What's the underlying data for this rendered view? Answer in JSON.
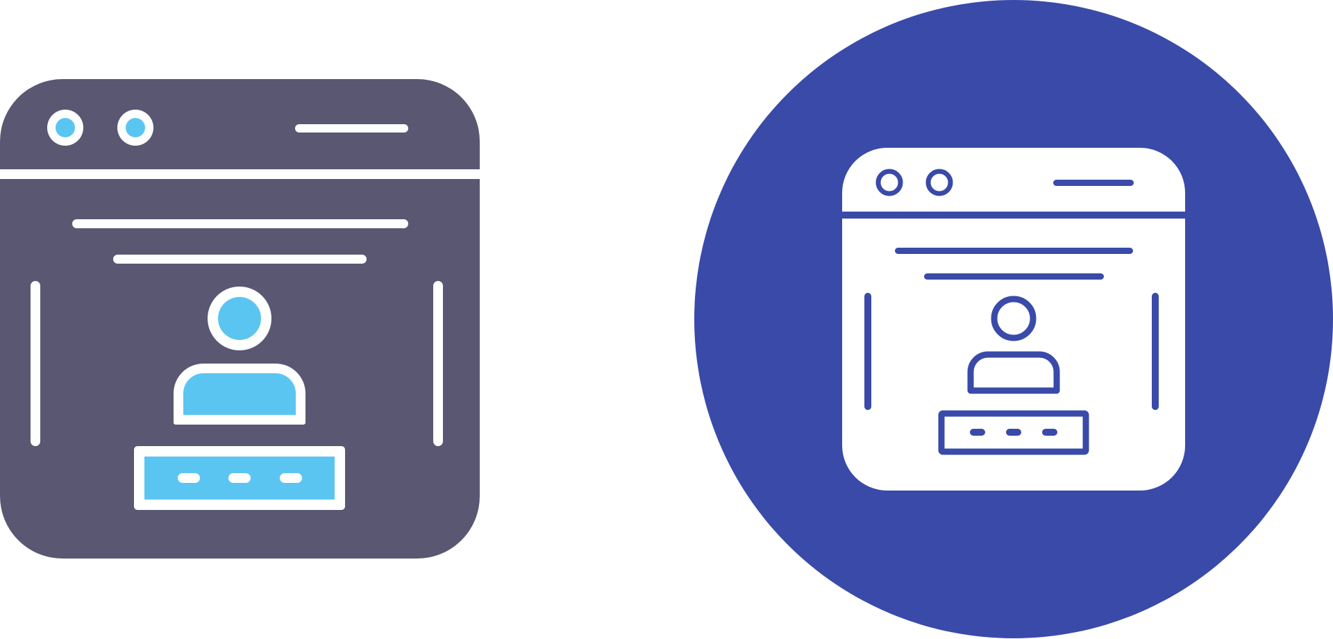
{
  "icons": [
    {
      "name": "login-window-icon-glyph",
      "style": "glyph",
      "colors": {
        "window": "#5a5773",
        "accent": "#5bc5f2",
        "lines": "#ffffff"
      }
    },
    {
      "name": "login-window-icon-circle",
      "style": "outline-on-circle",
      "colors": {
        "circle": "#3a4aa9",
        "window": "#ffffff",
        "lines": "#3a4aa9"
      }
    }
  ],
  "password_mask": "•••"
}
